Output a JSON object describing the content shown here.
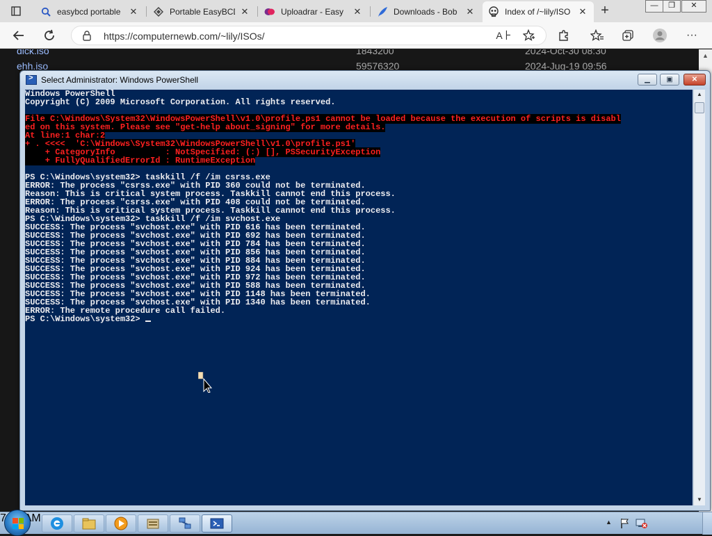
{
  "browser": {
    "tabs": [
      {
        "title": "easybcd portable",
        "icon": "search-icon"
      },
      {
        "title": "Portable EasyBCD",
        "icon": "diamond-icon"
      },
      {
        "title": "Uploadrar - Easy",
        "icon": "uploadrar-icon"
      },
      {
        "title": "Downloads - Bob",
        "icon": "feather-icon"
      },
      {
        "title": "Index of /~lily/ISO",
        "icon": "skull-icon",
        "active": true
      }
    ],
    "new_tab": "+",
    "url": "https://computernewb.com/~lily/ISOs/",
    "window_controls": {
      "minimize": "—",
      "restore": "❐",
      "close": "✕"
    }
  },
  "page": {
    "rows": [
      {
        "name": "dick.iso",
        "size": "1843200",
        "date": "2024-Oct-30 08:30"
      },
      {
        "name": "ehh.iso",
        "size": "59576320",
        "date": "2024-Jug-19 09:56"
      }
    ]
  },
  "powershell": {
    "title": "Select Administrator: Windows PowerShell",
    "header": [
      "Windows PowerShell",
      "Copyright (C) 2009 Microsoft Corporation. All rights reserved."
    ],
    "error_block": [
      "File C:\\Windows\\System32\\WindowsPowerShell\\v1.0\\profile.ps1 cannot be loaded because the execution of scripts is disabl",
      "ed on this system. Please see \"get-help about_signing\" for more details.",
      "At line:1 char:2",
      "+ . <<<<  'C:\\Windows\\System32\\WindowsPowerShell\\v1.0\\profile.ps1'",
      "    + CategoryInfo          : NotSpecified: (:) [], PSSecurityException",
      "    + FullyQualifiedErrorId : RuntimeException"
    ],
    "output": [
      "PS C:\\Windows\\system32> taskkill /f /im csrss.exe",
      "ERROR: The process \"csrss.exe\" with PID 360 could not be terminated.",
      "Reason: This is critical system process. Taskkill cannot end this process.",
      "ERROR: The process \"csrss.exe\" with PID 408 could not be terminated.",
      "Reason: This is critical system process. Taskkill cannot end this process.",
      "PS C:\\Windows\\system32> taskkill /f /im svchost.exe",
      "SUCCESS: The process \"svchost.exe\" with PID 616 has been terminated.",
      "SUCCESS: The process \"svchost.exe\" with PID 692 has been terminated.",
      "SUCCESS: The process \"svchost.exe\" with PID 784 has been terminated.",
      "SUCCESS: The process \"svchost.exe\" with PID 856 has been terminated.",
      "SUCCESS: The process \"svchost.exe\" with PID 884 has been terminated.",
      "SUCCESS: The process \"svchost.exe\" with PID 924 has been terminated.",
      "SUCCESS: The process \"svchost.exe\" with PID 972 has been terminated.",
      "SUCCESS: The process \"svchost.exe\" with PID 588 has been terminated.",
      "SUCCESS: The process \"svchost.exe\" with PID 1148 has been terminated.",
      "SUCCESS: The process \"svchost.exe\" with PID 1340 has been terminated.",
      "ERROR: The remote procedure call failed."
    ],
    "prompt": "PS C:\\Windows\\system32> ",
    "colors": {
      "background": "#012456",
      "text": "#eeedf0",
      "error": "#ff2020"
    }
  },
  "taskbar": {
    "items": [
      "ie-icon",
      "explorer-icon",
      "media-player-icon",
      "library-icon",
      "network-icon",
      "powershell-icon"
    ],
    "clock": "7:13 AM"
  }
}
